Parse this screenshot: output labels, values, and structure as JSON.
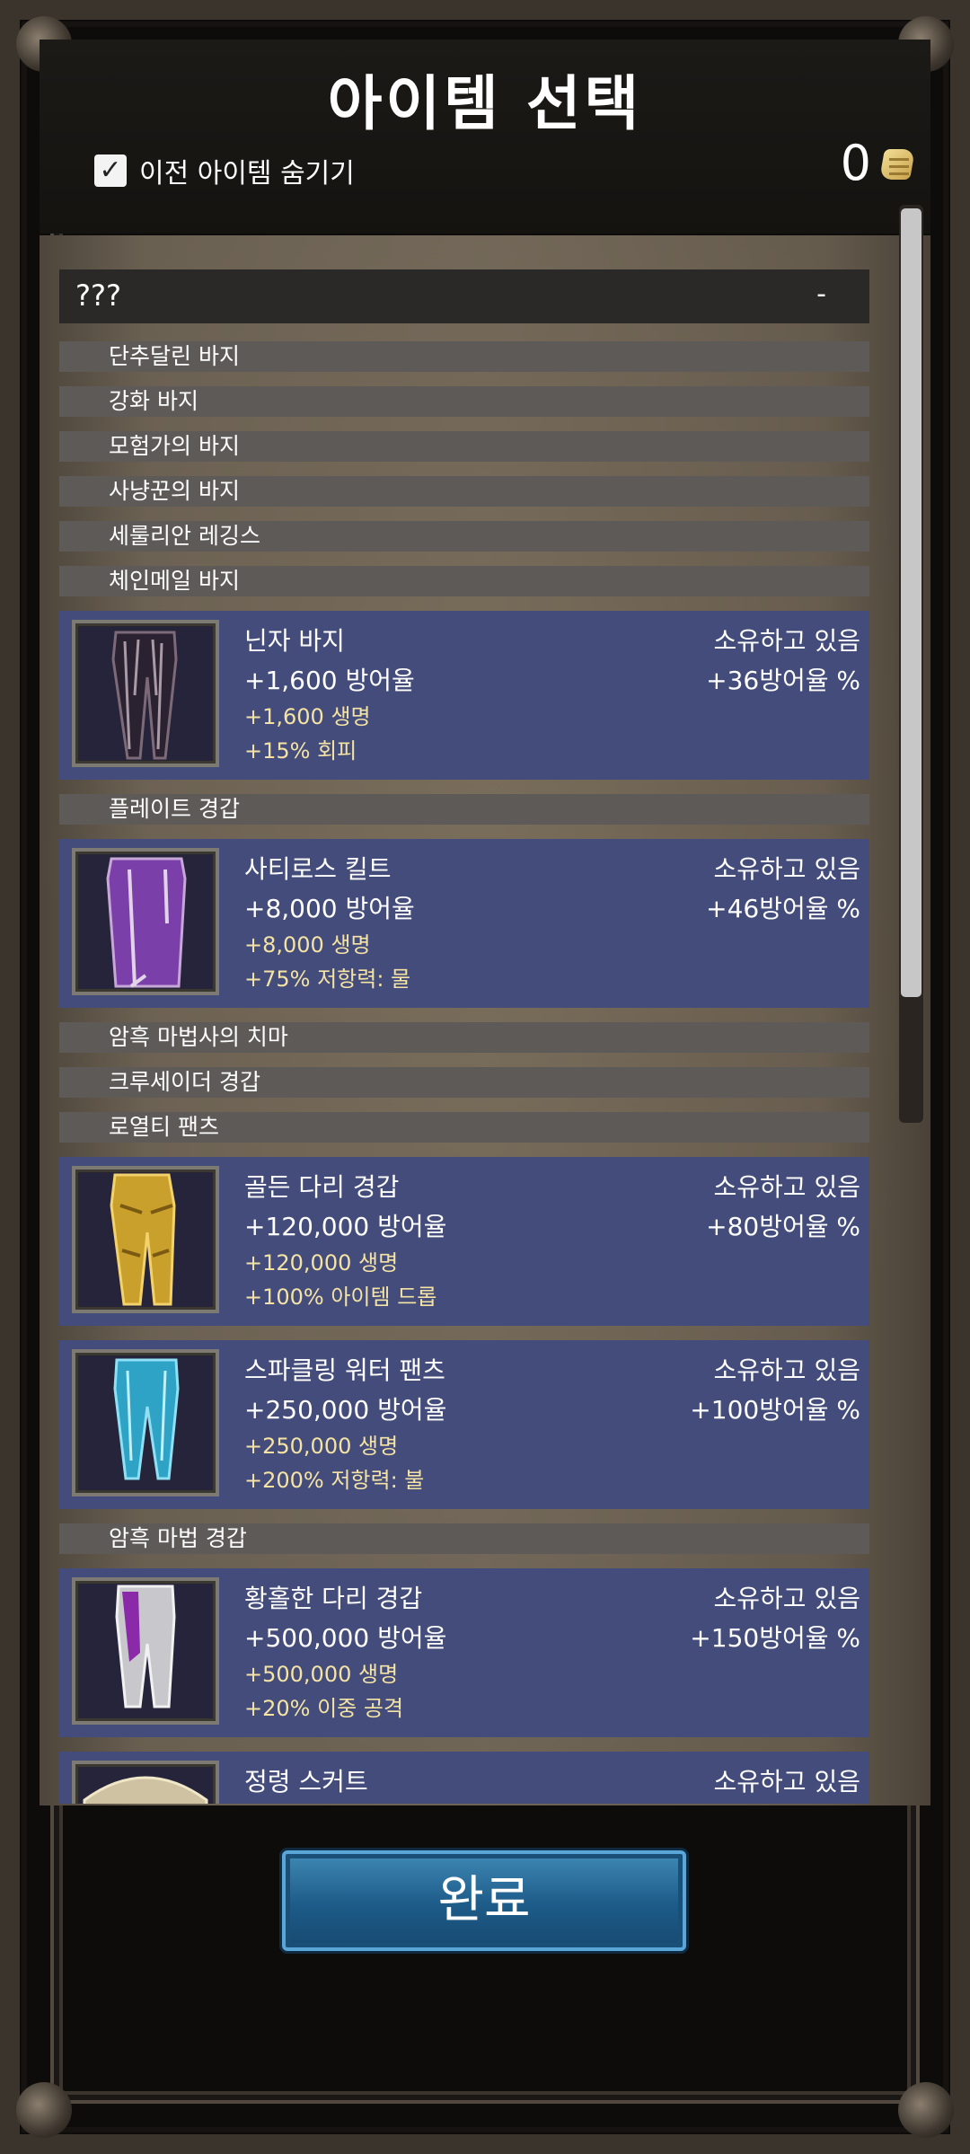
{
  "header": {
    "title": "아이템 선택",
    "hide_previous_label": "이전 아이템 숨기기",
    "hide_previous_checked": true,
    "currency_value": "0"
  },
  "list": {
    "unknown": {
      "name": "???",
      "value": "-"
    },
    "rows": [
      {
        "type": "simple",
        "name": "단추달린 바지"
      },
      {
        "type": "simple",
        "name": "강화 바지"
      },
      {
        "type": "simple",
        "name": "모험가의 바지"
      },
      {
        "type": "simple",
        "name": "사냥꾼의 바지"
      },
      {
        "type": "simple",
        "name": "세룰리안 레깅스"
      },
      {
        "type": "simple",
        "name": "체인메일 바지"
      },
      {
        "type": "owned",
        "name": "닌자 바지",
        "defense": "+1,600 방어율",
        "life": "+1,600 생명",
        "bonus": "+15% 회피",
        "owned": "소유하고 있음",
        "defense_pct": "+36방어율 %",
        "icon": "ninja-pants-icon"
      },
      {
        "type": "simple",
        "name": "플레이트 경갑"
      },
      {
        "type": "owned",
        "name": "사티로스 킬트",
        "defense": "+8,000 방어율",
        "life": "+8,000 생명",
        "bonus": "+75% 저항력: 물",
        "owned": "소유하고 있음",
        "defense_pct": "+46방어율 %",
        "icon": "satyr-kilt-icon"
      },
      {
        "type": "simple",
        "name": "암흑 마법사의 치마"
      },
      {
        "type": "simple",
        "name": "크루세이더 경갑"
      },
      {
        "type": "simple",
        "name": "로열티 팬츠"
      },
      {
        "type": "owned",
        "name": "골든 다리 경갑",
        "defense": "+120,000 방어율",
        "life": "+120,000 생명",
        "bonus": "+100% 아이템 드롭",
        "owned": "소유하고 있음",
        "defense_pct": "+80방어율 %",
        "icon": "golden-greaves-icon"
      },
      {
        "type": "owned",
        "name": "스파클링 워터 팬츠",
        "defense": "+250,000 방어율",
        "life": "+250,000 생명",
        "bonus": "+200% 저항력: 불",
        "owned": "소유하고 있음",
        "defense_pct": "+100방어율 %",
        "icon": "water-pants-icon"
      },
      {
        "type": "simple",
        "name": "암흑 마법 경갑"
      },
      {
        "type": "owned",
        "name": "황홀한 다리 경갑",
        "defense": "+500,000 방어율",
        "life": "+500,000 생명",
        "bonus": "+20% 이중 공격",
        "owned": "소유하고 있음",
        "defense_pct": "+150방어율 %",
        "icon": "ecstatic-greaves-icon"
      },
      {
        "type": "owned",
        "name": "정령 스커트",
        "defense": "",
        "life": "",
        "bonus": "",
        "owned": "소유하고 있음",
        "defense_pct": "",
        "icon": "spirit-skirt-icon"
      }
    ]
  },
  "footer": {
    "done_label": "완료"
  }
}
